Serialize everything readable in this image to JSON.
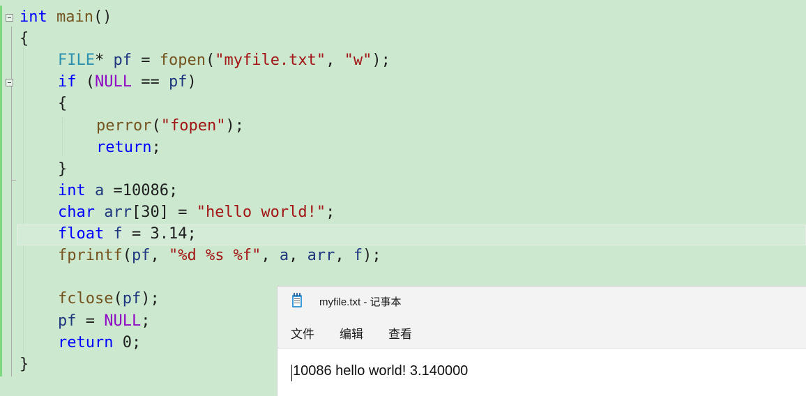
{
  "editor": {
    "lines": [
      {
        "indent": 0,
        "tokens": [
          {
            "t": "int",
            "c": "kw"
          },
          {
            "t": " "
          },
          {
            "t": "main",
            "c": "fn"
          },
          {
            "t": "()"
          }
        ]
      },
      {
        "indent": 0,
        "tokens": [
          {
            "t": "{"
          }
        ]
      },
      {
        "indent": 1,
        "tokens": [
          {
            "t": "FILE",
            "c": "ty"
          },
          {
            "t": "* "
          },
          {
            "t": "pf",
            "c": "var"
          },
          {
            "t": " = "
          },
          {
            "t": "fopen",
            "c": "fn"
          },
          {
            "t": "("
          },
          {
            "t": "\"myfile.txt\"",
            "c": "str"
          },
          {
            "t": ", "
          },
          {
            "t": "\"w\"",
            "c": "str"
          },
          {
            "t": ");"
          }
        ]
      },
      {
        "indent": 1,
        "tokens": [
          {
            "t": "if",
            "c": "kw"
          },
          {
            "t": " ("
          },
          {
            "t": "NULL",
            "c": "mac"
          },
          {
            "t": " == "
          },
          {
            "t": "pf",
            "c": "var"
          },
          {
            "t": ")"
          }
        ]
      },
      {
        "indent": 1,
        "tokens": [
          {
            "t": "{"
          }
        ]
      },
      {
        "indent": 2,
        "tokens": [
          {
            "t": "perror",
            "c": "fn"
          },
          {
            "t": "("
          },
          {
            "t": "\"fopen\"",
            "c": "str"
          },
          {
            "t": ");"
          }
        ]
      },
      {
        "indent": 2,
        "tokens": [
          {
            "t": "return",
            "c": "kw"
          },
          {
            "t": ";"
          }
        ]
      },
      {
        "indent": 1,
        "tokens": [
          {
            "t": "}"
          }
        ]
      },
      {
        "indent": 1,
        "tokens": [
          {
            "t": "int",
            "c": "kw"
          },
          {
            "t": " "
          },
          {
            "t": "a",
            "c": "var"
          },
          {
            "t": " =10086;"
          }
        ]
      },
      {
        "indent": 1,
        "tokens": [
          {
            "t": "char",
            "c": "kw"
          },
          {
            "t": " "
          },
          {
            "t": "arr",
            "c": "var"
          },
          {
            "t": "[30] = "
          },
          {
            "t": "\"hello world!\"",
            "c": "str"
          },
          {
            "t": ";"
          }
        ]
      },
      {
        "indent": 1,
        "tokens": [
          {
            "t": "float",
            "c": "kw"
          },
          {
            "t": " "
          },
          {
            "t": "f",
            "c": "var"
          },
          {
            "t": " = 3.14;"
          }
        ]
      },
      {
        "indent": 1,
        "tokens": [
          {
            "t": "fprintf",
            "c": "fn"
          },
          {
            "t": "("
          },
          {
            "t": "pf",
            "c": "var"
          },
          {
            "t": ", "
          },
          {
            "t": "\"%d %s %f\"",
            "c": "str"
          },
          {
            "t": ", "
          },
          {
            "t": "a",
            "c": "var"
          },
          {
            "t": ", "
          },
          {
            "t": "arr",
            "c": "var"
          },
          {
            "t": ", "
          },
          {
            "t": "f",
            "c": "var"
          },
          {
            "t": ");"
          }
        ]
      },
      {
        "indent": 1,
        "tokens": []
      },
      {
        "indent": 1,
        "tokens": [
          {
            "t": "fclose",
            "c": "fn"
          },
          {
            "t": "("
          },
          {
            "t": "pf",
            "c": "var"
          },
          {
            "t": ");"
          }
        ]
      },
      {
        "indent": 1,
        "tokens": [
          {
            "t": "pf",
            "c": "var"
          },
          {
            "t": " = "
          },
          {
            "t": "NULL",
            "c": "mac"
          },
          {
            "t": ";"
          }
        ]
      },
      {
        "indent": 1,
        "tokens": [
          {
            "t": "return",
            "c": "kw"
          },
          {
            "t": " 0;"
          }
        ]
      },
      {
        "indent": 0,
        "tokens": [
          {
            "t": "}"
          }
        ]
      }
    ],
    "colors": {
      "background": "#cce8cf",
      "keyword": "#0000ff",
      "function": "#74531f",
      "type": "#2b91af",
      "macro": "#8f08c4",
      "string": "#a31515",
      "variable": "#1f377f"
    }
  },
  "notepad": {
    "title": "myfile.txt - 记事本",
    "icon": "notepad-icon",
    "menu": {
      "file": "文件",
      "edit": "编辑",
      "view": "查看"
    },
    "content": "10086 hello world! 3.140000"
  }
}
